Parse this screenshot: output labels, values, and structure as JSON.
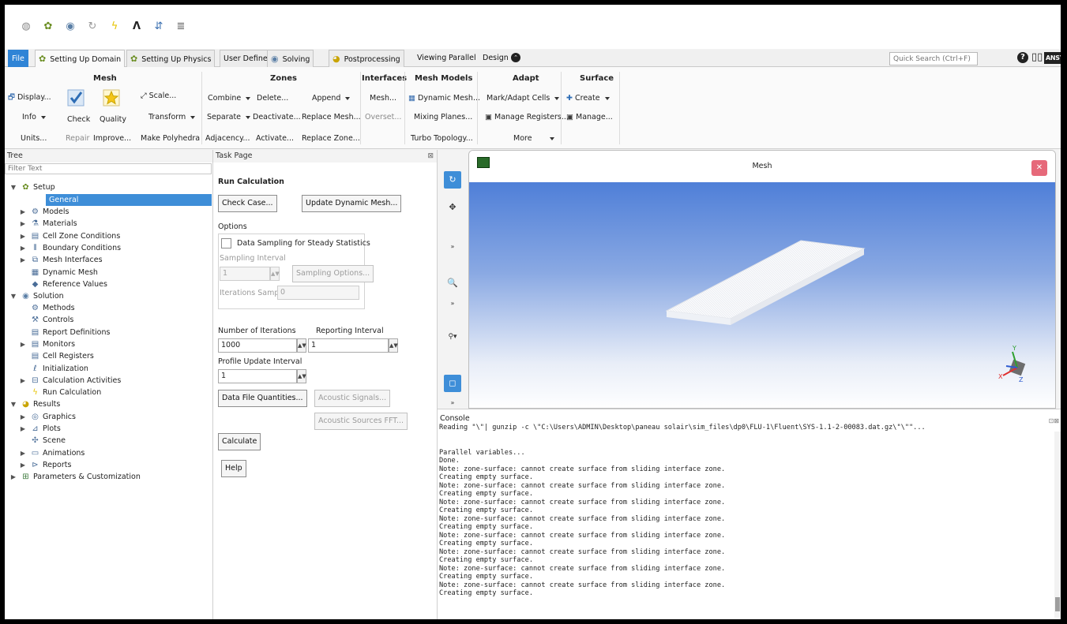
{
  "quick_access": {
    "icons": [
      "case-icon",
      "setup-icon",
      "solution-icon",
      "refresh-icon",
      "lightning-icon",
      "ansys-a-icon",
      "transfer-icon",
      "parallel-icon"
    ]
  },
  "tabs": [
    {
      "label": "File"
    },
    {
      "label": "Setting Up Domain"
    },
    {
      "label": "Setting Up Physics"
    },
    {
      "label": "User Defined"
    },
    {
      "label": "Solving"
    },
    {
      "label": "Postprocessing"
    },
    {
      "label": "Viewing"
    },
    {
      "label": "Parallel"
    },
    {
      "label": "Design"
    }
  ],
  "search": {
    "placeholder": "Quick Search (Ctrl+F)"
  },
  "brand": {
    "logo": "ANSYS"
  },
  "ribbon": {
    "mesh": {
      "title": "Mesh",
      "display": "Display...",
      "info": "Info",
      "units": "Units...",
      "check": "Check",
      "repair": "Repair",
      "quality": "Quality",
      "improve": "Improve...",
      "scale": "Scale...",
      "transform": "Transform",
      "make_polyhedra": "Make Polyhedra"
    },
    "zones": {
      "title": "Zones",
      "combine": "Combine",
      "separate": "Separate",
      "adjacency": "Adjacency...",
      "delete": "Delete...",
      "deactivate": "Deactivate...",
      "activate": "Activate...",
      "append": "Append",
      "replace_mesh": "Replace Mesh...",
      "replace_zone": "Replace Zone..."
    },
    "interfaces": {
      "title": "Interfaces",
      "mesh": "Mesh...",
      "overset": "Overset..."
    },
    "mesh_models": {
      "title": "Mesh Models",
      "dynamic_mesh": "Dynamic Mesh...",
      "mixing_planes": "Mixing Planes...",
      "turbo_topology": "Turbo Topology..."
    },
    "adapt": {
      "title": "Adapt",
      "mark_adapt": "Mark/Adapt Cells",
      "manage_registers": "Manage Registers...",
      "more": "More"
    },
    "surface": {
      "title": "Surface",
      "create": "Create",
      "manage": "Manage..."
    }
  },
  "tree": {
    "header": "Tree",
    "filter_placeholder": "Filter Text",
    "items": [
      {
        "label": "Setup",
        "icon": "setup-icon"
      },
      {
        "label": "General",
        "icon": "general-icon"
      },
      {
        "label": "Models",
        "icon": "models-icon"
      },
      {
        "label": "Materials",
        "icon": "materials-icon"
      },
      {
        "label": "Cell Zone Conditions",
        "icon": "cell-zone-icon"
      },
      {
        "label": "Boundary Conditions",
        "icon": "boundary-icon"
      },
      {
        "label": "Mesh Interfaces",
        "icon": "mesh-interfaces-icon"
      },
      {
        "label": "Dynamic Mesh",
        "icon": "dynamic-mesh-icon"
      },
      {
        "label": "Reference Values",
        "icon": "reference-values-icon"
      },
      {
        "label": "Solution",
        "icon": "solution-icon"
      },
      {
        "label": "Methods",
        "icon": "methods-icon"
      },
      {
        "label": "Controls",
        "icon": "controls-icon"
      },
      {
        "label": "Report Definitions",
        "icon": "report-definitions-icon"
      },
      {
        "label": "Monitors",
        "icon": "monitors-icon"
      },
      {
        "label": "Cell Registers",
        "icon": "cell-registers-icon"
      },
      {
        "label": "Initialization",
        "icon": "initialization-icon"
      },
      {
        "label": "Calculation Activities",
        "icon": "calculation-activities-icon"
      },
      {
        "label": "Run Calculation",
        "icon": "run-calculation-icon"
      },
      {
        "label": "Results",
        "icon": "results-icon"
      },
      {
        "label": "Graphics",
        "icon": "graphics-icon"
      },
      {
        "label": "Plots",
        "icon": "plots-icon"
      },
      {
        "label": "Scene",
        "icon": "scene-icon"
      },
      {
        "label": "Animations",
        "icon": "animations-icon"
      },
      {
        "label": "Reports",
        "icon": "reports-icon"
      },
      {
        "label": "Parameters & Customization",
        "icon": "parameters-icon"
      }
    ]
  },
  "task": {
    "header": "Task Page",
    "title": "Run Calculation",
    "check_case": "Check Case...",
    "update_dynamic_mesh": "Update Dynamic Mesh...",
    "options_label": "Options",
    "data_sampling": "Data Sampling for Steady Statistics",
    "sampling_interval_label": "Sampling Interval",
    "sampling_interval_value": "1",
    "sampling_options": "Sampling Options...",
    "iterations_sampled_label": "Iterations Sampled",
    "iterations_sampled_value": "0",
    "num_iterations_label": "Number of Iterations",
    "num_iterations_value": "1000",
    "reporting_interval_label": "Reporting Interval",
    "reporting_interval_value": "1",
    "profile_update_label": "Profile Update Interval",
    "profile_update_value": "1",
    "data_file_quantities": "Data File Quantities...",
    "acoustic_signals": "Acoustic Signals...",
    "acoustic_sources_fft": "Acoustic Sources FFT...",
    "calculate": "Calculate",
    "help": "Help"
  },
  "graphics": {
    "title": "Mesh"
  },
  "console": {
    "header": "Console",
    "lines": [
      "Reading \"\\\"| gunzip -c \\\"C:\\Users\\ADMIN\\Desktop\\paneau solair\\sim_files\\dp0\\FLU-1\\Fluent\\SYS-1.1-2-00083.dat.gz\\\"\\\"\"...",
      "",
      "",
      "Parallel variables...",
      "Done.",
      "Note: zone-surface: cannot create surface from sliding interface zone.",
      "Creating empty surface.",
      "Note: zone-surface: cannot create surface from sliding interface zone.",
      "Creating empty surface.",
      "Note: zone-surface: cannot create surface from sliding interface zone.",
      "Creating empty surface.",
      "Note: zone-surface: cannot create surface from sliding interface zone.",
      "Creating empty surface.",
      "Note: zone-surface: cannot create surface from sliding interface zone.",
      "Creating empty surface.",
      "Note: zone-surface: cannot create surface from sliding interface zone.",
      "Creating empty surface.",
      "Note: zone-surface: cannot create surface from sliding interface zone.",
      "Creating empty surface.",
      "Note: zone-surface: cannot create surface from sliding interface zone.",
      "Creating empty surface."
    ]
  },
  "colors": {
    "accent": "#3e8ed8",
    "file_tab": "#2f84d6",
    "close_button": "#e6697a",
    "viewport_top": "#4f7fd8",
    "viewport_bottom": "#ffffff"
  }
}
